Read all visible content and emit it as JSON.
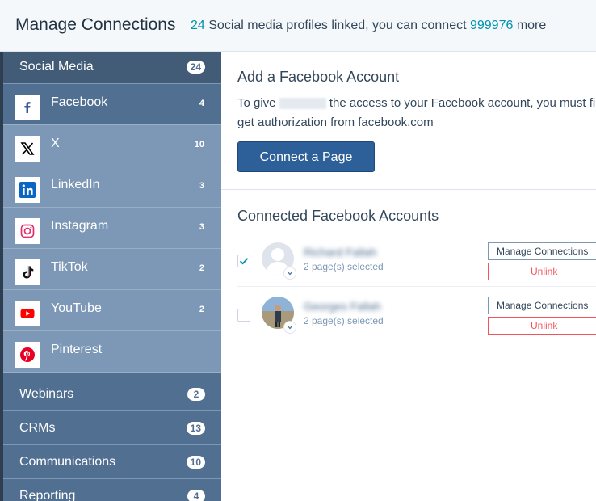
{
  "header": {
    "title": "Manage Connections",
    "linked_count": "24",
    "linked_text": " Social media profiles linked, you can connect ",
    "remaining_count": "999976",
    "remaining_text": " more"
  },
  "sidebar": {
    "social": {
      "label": "Social Media",
      "badge": "24"
    },
    "items": [
      {
        "label": "Facebook",
        "count": "4",
        "icon": "facebook-icon"
      },
      {
        "label": "X",
        "count": "10",
        "icon": "x-icon"
      },
      {
        "label": "LinkedIn",
        "count": "3",
        "icon": "linkedin-icon"
      },
      {
        "label": "Instagram",
        "count": "3",
        "icon": "instagram-icon"
      },
      {
        "label": "TikTok",
        "count": "2",
        "icon": "tiktok-icon"
      },
      {
        "label": "YouTube",
        "count": "2",
        "icon": "youtube-icon"
      },
      {
        "label": "Pinterest",
        "count": "",
        "icon": "pinterest-icon"
      }
    ],
    "categories": [
      {
        "label": "Webinars",
        "badge": "2"
      },
      {
        "label": "CRMs",
        "badge": "13"
      },
      {
        "label": "Communications",
        "badge": "10"
      },
      {
        "label": "Reporting",
        "badge": "4"
      }
    ]
  },
  "main": {
    "add_title": "Add a Facebook Account",
    "desc_before": "To give ",
    "desc_after": " the access to your Facebook account, you must first get authorization from facebook.com",
    "connect_button": "Connect a Page",
    "connected_title": "Connected Facebook Accounts",
    "accounts": [
      {
        "name": "Richard Fallah",
        "pages": "2 page(s) selected",
        "checked": true,
        "manage": "Manage Connections",
        "unlink": "Unlink"
      },
      {
        "name": "Georges Fallah",
        "pages": "2 page(s) selected",
        "checked": false,
        "manage": "Manage Connections",
        "unlink": "Unlink"
      }
    ]
  },
  "colors": {
    "accent": "#0091ae",
    "sidebar": "#516f90",
    "sidebar_sub": "#7c98b6",
    "button": "#2d5f99",
    "danger": "#f2545b"
  }
}
